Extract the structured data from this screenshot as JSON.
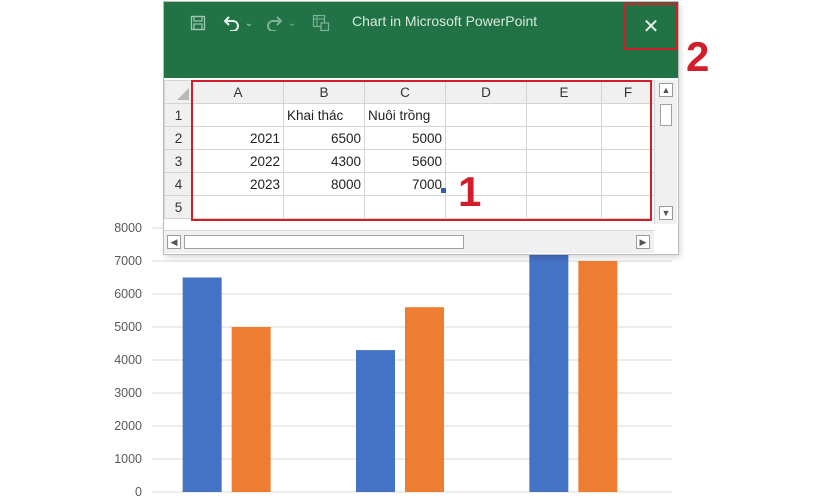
{
  "window": {
    "title": "Chart in Microsoft PowerPoint",
    "close_label": "✕",
    "icons": [
      "save-icon",
      "undo-icon",
      "redo-icon",
      "edit-data-in-excel-icon"
    ]
  },
  "spreadsheet": {
    "columns": [
      "A",
      "B",
      "C",
      "D",
      "E",
      "F"
    ],
    "rows": [
      {
        "num": "1",
        "cells": [
          "",
          "Khai thác",
          "Nuôi trồng",
          "",
          "",
          ""
        ]
      },
      {
        "num": "2",
        "cells": [
          "2021",
          "6500",
          "5000",
          "",
          "",
          ""
        ]
      },
      {
        "num": "3",
        "cells": [
          "2022",
          "4300",
          "5600",
          "",
          "",
          ""
        ]
      },
      {
        "num": "4",
        "cells": [
          "2023",
          "8000",
          "7000",
          "",
          "",
          ""
        ]
      },
      {
        "num": "5",
        "cells": [
          "",
          "",
          "",
          "",
          "",
          ""
        ]
      }
    ]
  },
  "annotations": {
    "badge_1": "1",
    "badge_2": "2",
    "color": "#d21e2b"
  },
  "colors": {
    "titlebar": "#217346",
    "series_1": "#4472c4",
    "series_2": "#ed7d31"
  },
  "chart_data": {
    "type": "bar",
    "categories": [
      "2021",
      "2022",
      "2023"
    ],
    "series": [
      {
        "name": "Khai thác",
        "values": [
          6500,
          4300,
          8000
        ],
        "color": "#4472c4"
      },
      {
        "name": "Nuôi trồng",
        "values": [
          5000,
          5600,
          7000
        ],
        "color": "#ed7d31"
      }
    ],
    "yticks": [
      0,
      1000,
      2000,
      3000,
      4000,
      5000,
      6000,
      7000,
      8000
    ],
    "ylim": [
      0,
      8000
    ],
    "grid": true
  }
}
